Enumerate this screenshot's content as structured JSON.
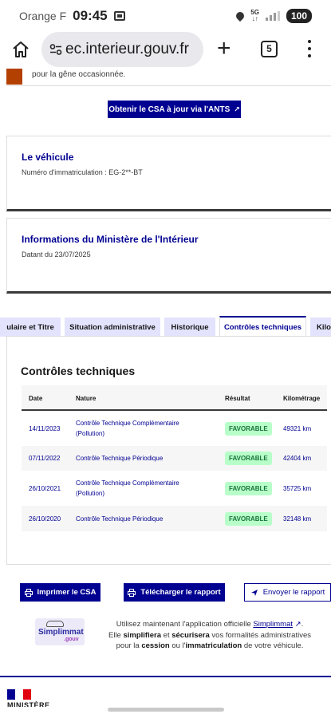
{
  "status_bar": {
    "carrier": "Orange F",
    "time": "09:45",
    "network": "5G",
    "battery": "100"
  },
  "browser": {
    "url": "ec.interieur.gouv.fr",
    "tab_count": "5",
    "icons": [
      "home-icon",
      "site-settings-icon",
      "new-tab-icon",
      "tabs-icon",
      "menu-icon"
    ]
  },
  "alert": {
    "text": "pour la gêne occasionnée."
  },
  "csa_button": {
    "label": "Obtenir le CSA à jour via l'ANTS"
  },
  "vehicle_card": {
    "title": "Le véhicule",
    "registration": "Numéro d'immatriculation : EG-2**-BT"
  },
  "ministry_card": {
    "title": "Informations du Ministère de l'Intérieur",
    "date": "Datant du 23/07/2025"
  },
  "tabs": [
    {
      "label": "ulaire et Titre"
    },
    {
      "label": "Situation administrative"
    },
    {
      "label": "Historique"
    },
    {
      "label": "Contrôles techniques"
    },
    {
      "label": "Kilo"
    }
  ],
  "controles": {
    "title": "Contrôles techniques",
    "headers": {
      "date": "Date",
      "nature": "Nature",
      "resultat": "Résultat",
      "kilometrage": "Kilométrage"
    },
    "rows": [
      {
        "date": "14/11/2023",
        "nature_l1": "Contrôle Technique Complémentaire",
        "nature_l2": "(Pollution)",
        "resultat": "FAVORABLE",
        "km": "49321 km"
      },
      {
        "date": "07/11/2022",
        "nature_l1": "Contrôle Technique Périodique",
        "nature_l2": "",
        "resultat": "FAVORABLE",
        "km": "42404 km"
      },
      {
        "date": "26/10/2021",
        "nature_l1": "Contrôle Technique Complémentaire",
        "nature_l2": "(Pollution)",
        "resultat": "FAVORABLE",
        "km": "35725 km"
      },
      {
        "date": "26/10/2020",
        "nature_l1": "Contrôle Technique Périodique",
        "nature_l2": "",
        "resultat": "FAVORABLE",
        "km": "32148 km"
      }
    ]
  },
  "actions": {
    "print": "Imprimer le CSA",
    "download": "Télécharger le rapport",
    "send": "Envoyer le rapport"
  },
  "promo": {
    "logo_line1": "Simplimmat",
    "logo_line2": ".gouv",
    "text_before": "Utilisez maintenant l'application officielle ",
    "link": "Simplimmat",
    "text_2a": "Elle ",
    "bold_1": "simplifiera",
    "text_2b": " et ",
    "bold_2": "sécurisera",
    "text_2c": " vos formalités administratives",
    "text_3a": "pour la ",
    "bold_3": "cession",
    "text_3b": " ou l'",
    "bold_4": "immatriculation",
    "text_3c": " de votre véhicule."
  },
  "footer": {
    "ministere": "MINISTÈRE"
  },
  "colors": {
    "primary": "#000091",
    "tab_bg": "#e3e3fd",
    "success_bg": "#b8fec9",
    "success_text": "#18753c",
    "alert": "#b34000"
  }
}
